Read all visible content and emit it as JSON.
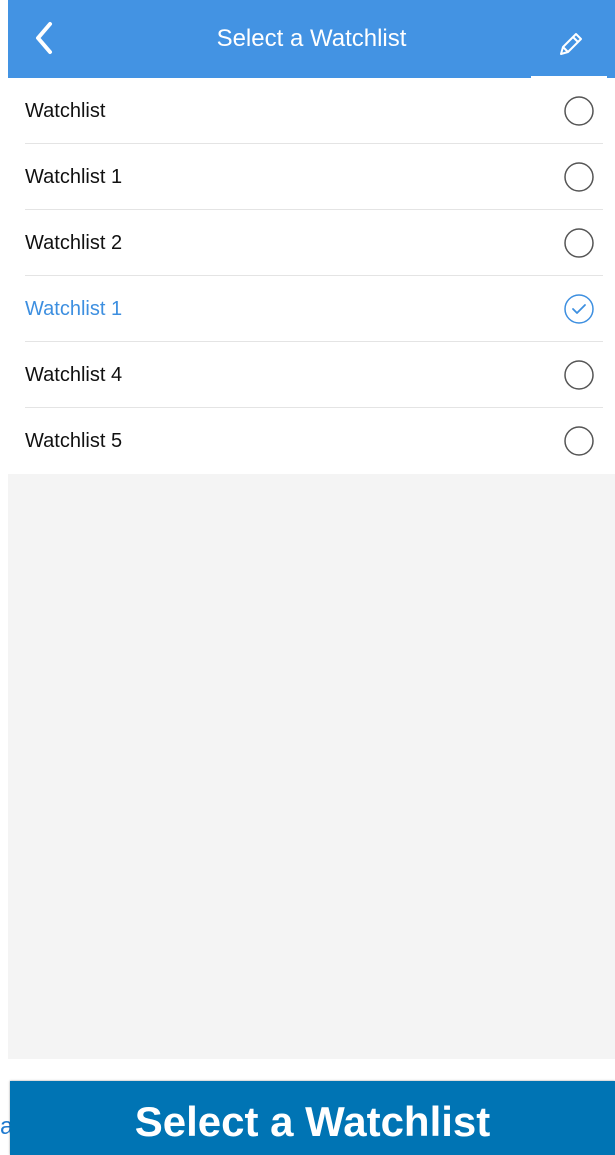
{
  "header": {
    "title": "Select a Watchlist",
    "back_icon": "chevron-left-icon",
    "edit_icon": "pencil-icon"
  },
  "watchlists": [
    {
      "label": "Watchlist",
      "selected": false
    },
    {
      "label": "Watchlist 1",
      "selected": false
    },
    {
      "label": "Watchlist 2",
      "selected": false
    },
    {
      "label": "Watchlist 1",
      "selected": true
    },
    {
      "label": "Watchlist 4",
      "selected": false
    },
    {
      "label": "Watchlist 5",
      "selected": false
    }
  ],
  "caption": {
    "title": "Select a Watchlist",
    "edge_fragment": "a"
  },
  "colors": {
    "header_bg": "#4393e3",
    "selected": "#3d8fe0",
    "highlight": "#45b8f5",
    "caption_bg": "#0074b4"
  }
}
